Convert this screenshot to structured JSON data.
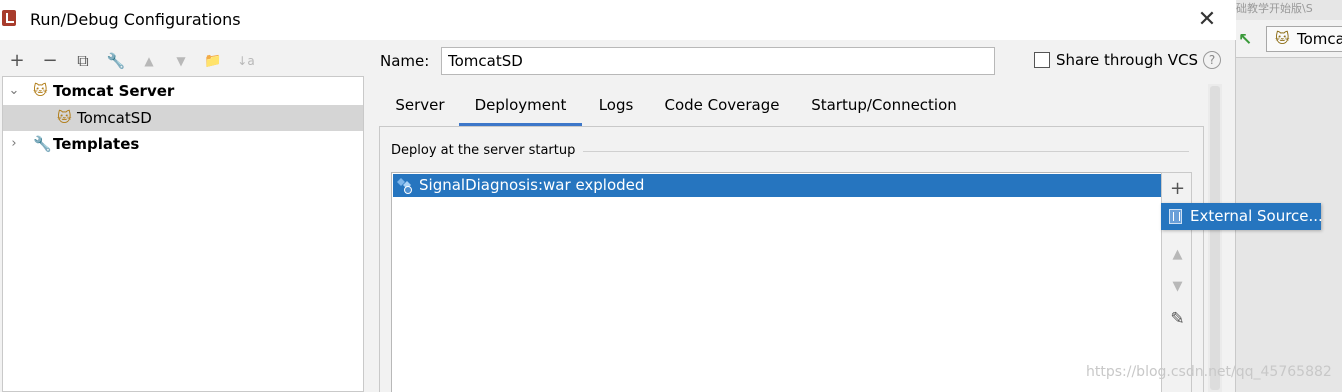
{
  "window": {
    "title": "Run/Debug Configurations",
    "close_glyph": "✕"
  },
  "background_ide": {
    "tab_label": "Tomca",
    "top_text": "础教学开始版\\S"
  },
  "toolbar": {
    "add": "+",
    "remove": "−",
    "copy": "⧉",
    "edit_defaults": "🔧",
    "move_up": "▲",
    "move_down": "▼",
    "folder": "📁",
    "sort": "↓a"
  },
  "tree": {
    "items": [
      {
        "label": "Tomcat Server",
        "icon": "tomcat-icon",
        "expanded": true,
        "bold": true
      },
      {
        "label": "TomcatSD",
        "icon": "tomcat-icon",
        "selected": true
      },
      {
        "label": "Templates",
        "icon": "wrench-icon",
        "expanded": false,
        "bold": true
      }
    ]
  },
  "config": {
    "name_label": "Name:",
    "name_value": "TomcatSD",
    "share_label": "Share through VCS",
    "share_checked": false,
    "help": "?"
  },
  "tabs": [
    {
      "label": "Server",
      "active": false
    },
    {
      "label": "Deployment",
      "active": true
    },
    {
      "label": "Logs",
      "active": false
    },
    {
      "label": "Code Coverage",
      "active": false
    },
    {
      "label": "Startup/Connection",
      "active": false
    }
  ],
  "deployment": {
    "group_title": "Deploy at the server startup",
    "artifacts": [
      "SignalDiagnosis:war exploded"
    ],
    "side_buttons": {
      "add": "+",
      "up": "▲",
      "down": "▼",
      "edit": "✎"
    },
    "popup_item": "External Source..."
  },
  "watermark": "https://blog.csdn.net/qq_45765882",
  "colors": {
    "selection": "#2675bf",
    "tab_underline": "#3d77c9",
    "panel_bg": "#f2f2f2"
  }
}
